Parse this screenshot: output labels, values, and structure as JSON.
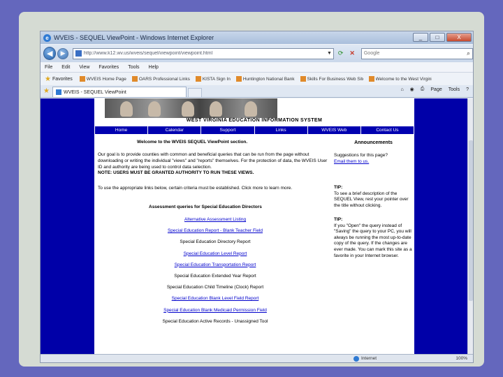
{
  "window": {
    "title": "WVEIS - SEQUEL ViewPoint - Windows Internet Explorer",
    "controls": [
      "_",
      "□",
      "X"
    ]
  },
  "address": {
    "url": "http://www.k12.wv.us/wveis/sequel/viewpoint/viewpoint.html",
    "search_provider": "Google"
  },
  "menu": [
    "File",
    "Edit",
    "View",
    "Favorites",
    "Tools",
    "Help"
  ],
  "favorites": {
    "label": "Favorites",
    "items": [
      "WVEIS Home Page",
      "OARS Professional Links",
      "KISTA Sign In",
      "Huntington National Bank",
      "Skills For Business Web Sites",
      "Welcome to the West Virginia"
    ]
  },
  "tab": {
    "title": "WVEIS - SEQUEL ViewPoint"
  },
  "command_bar": [
    "Page",
    "Tools"
  ],
  "site": {
    "name": "WEST VIRGINIA EDUCATION INFORMATION SYSTEM",
    "nav": [
      "Home",
      "Calendar",
      "Support",
      "Links",
      "WVEIS Web",
      "Contact Us"
    ],
    "welcome": "Welcome to the WVEIS SEQUEL ViewPoint section.",
    "intro": "Our goal is to provide counties with common and beneficial queries that can be run from the page without downloading or writing the individual \"views\" and \"reports\" themselves. For the protection of data, the WVEIS User ID and authority are being used to control data selection.",
    "note": "NOTE: USERS MUST BE GRANTED AUTHORITY TO RUN THESE VIEWS.",
    "link_instructions": "To use the appropriate links below, certain criteria must be established. Click more to learn more.",
    "section_heading": "Assessment queries for Special Education Directors",
    "queries": [
      {
        "label": "Alternative Assessment Listing",
        "link": true
      },
      {
        "label": "Special Education Report - Blank Teacher Field",
        "link": true
      },
      {
        "label": "Special Education Directory Report",
        "link": false
      },
      {
        "label": "Special Education Level Report",
        "link": true
      },
      {
        "label": "Special Education Transportation Report",
        "link": true
      },
      {
        "label": "Special Education Extended Year Report",
        "link": false
      },
      {
        "label": "Special Education Child Timeline (Clock) Report",
        "link": false
      },
      {
        "label": "Special Education Blank Level Field Report",
        "link": true
      },
      {
        "label": "Special Education Blank Medicaid Permission Field",
        "link": true
      },
      {
        "label": "Special Education Active Records - Unassigned Tool",
        "link": false
      }
    ],
    "sidebar": {
      "heading": "Announcements",
      "suggestion": "Suggestions for this page?",
      "email_link": "Email them to us.",
      "tip1_label": "TIP:",
      "tip1": "To see a brief description of the SEQUEL View, rest your pointer over the title without clicking.",
      "tip2_label": "TIP:",
      "tip2": "If you \"Open\" the query instead of \"Saving\" the query to your PC, you will always be running the most up-to-date copy of the query. If the changes are ever made. You can mark this site as a favorite in your Internet browser."
    }
  },
  "status": {
    "zone": "Internet",
    "zoom": "100%"
  }
}
